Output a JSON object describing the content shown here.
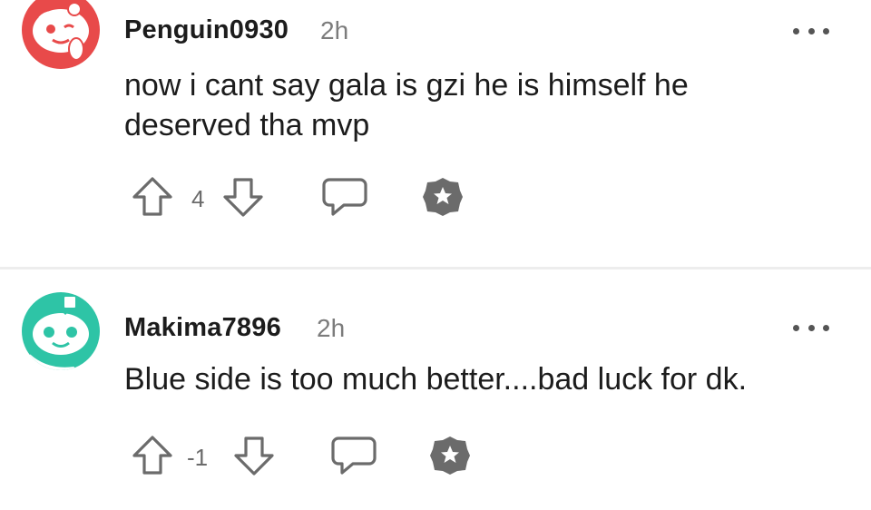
{
  "comments": [
    {
      "username": "Penguin0930",
      "time": "2h",
      "text_line1": "now i cant say gala is gzi he is himself he",
      "text_line2": "deserved tha mvp",
      "score": "4",
      "avatar_color": "#e84a4a"
    },
    {
      "username": "Makima7896",
      "time": "2h",
      "text_line1": "Blue side is too much better....bad luck for dk.",
      "score": "-1",
      "avatar_color": "#2ec4a6"
    }
  ],
  "icons": {
    "upvote": "arrow-up-outline-icon",
    "downvote": "arrow-down-outline-icon",
    "reply": "speech-bubble-icon",
    "award": "star-badge-icon",
    "more": "ellipsis-icon"
  },
  "colors": {
    "text": "#1c1c1c",
    "meta": "#7c7c7c",
    "icon": "#6b6b6b",
    "divider": "#ededed"
  }
}
